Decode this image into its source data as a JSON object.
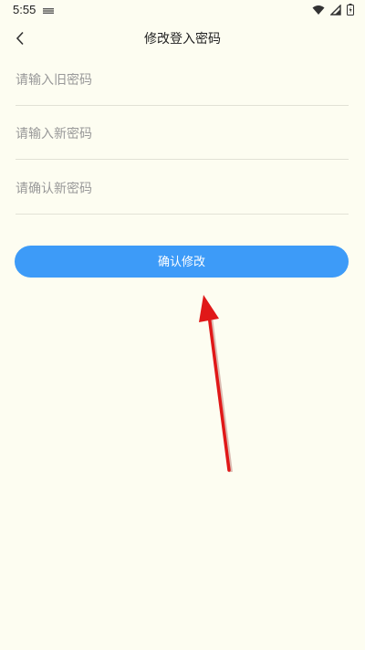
{
  "status_bar": {
    "time": "5:55",
    "icons": [
      "notification-icon",
      "wifi-icon",
      "signal-icon",
      "battery-icon"
    ]
  },
  "header": {
    "title": "修改登入密码",
    "back_icon": "chevron-left-icon"
  },
  "form": {
    "old_password": {
      "placeholder": "请输入旧密码",
      "value": ""
    },
    "new_password": {
      "placeholder": "请输入新密码",
      "value": ""
    },
    "confirm_password": {
      "placeholder": "请确认新密码",
      "value": ""
    },
    "submit_label": "确认修改"
  },
  "colors": {
    "background": "#fdfdf1",
    "accent": "#3d9bf8",
    "annotation_arrow": "#e01818"
  }
}
